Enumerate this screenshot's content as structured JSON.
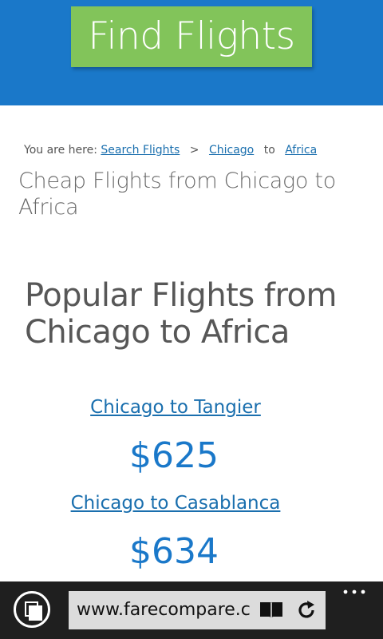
{
  "header": {
    "find_button_label": "Find Flights"
  },
  "breadcrumb": {
    "prefix": "You are here:",
    "link1": "Search Flights",
    "separator": ">",
    "link2": "Chicago",
    "connector": "to",
    "link3": "Africa"
  },
  "page_title": "Cheap Flights from Chicago to Africa",
  "section_title": "Popular Flights from Chicago to Africa",
  "flights": [
    {
      "route": "Chicago to Tangier",
      "price": "$625"
    },
    {
      "route": "Chicago to Casablanca",
      "price": "$634"
    }
  ],
  "browser": {
    "url": "www.farecompare.c",
    "icons": [
      "tabs-icon",
      "reader-icon",
      "refresh-icon",
      "more-icon"
    ]
  },
  "colors": {
    "header_bg": "#1a78c9",
    "button_green": "#82c45a",
    "link_blue": "#1a6fae",
    "price_blue": "#1a78c9"
  }
}
